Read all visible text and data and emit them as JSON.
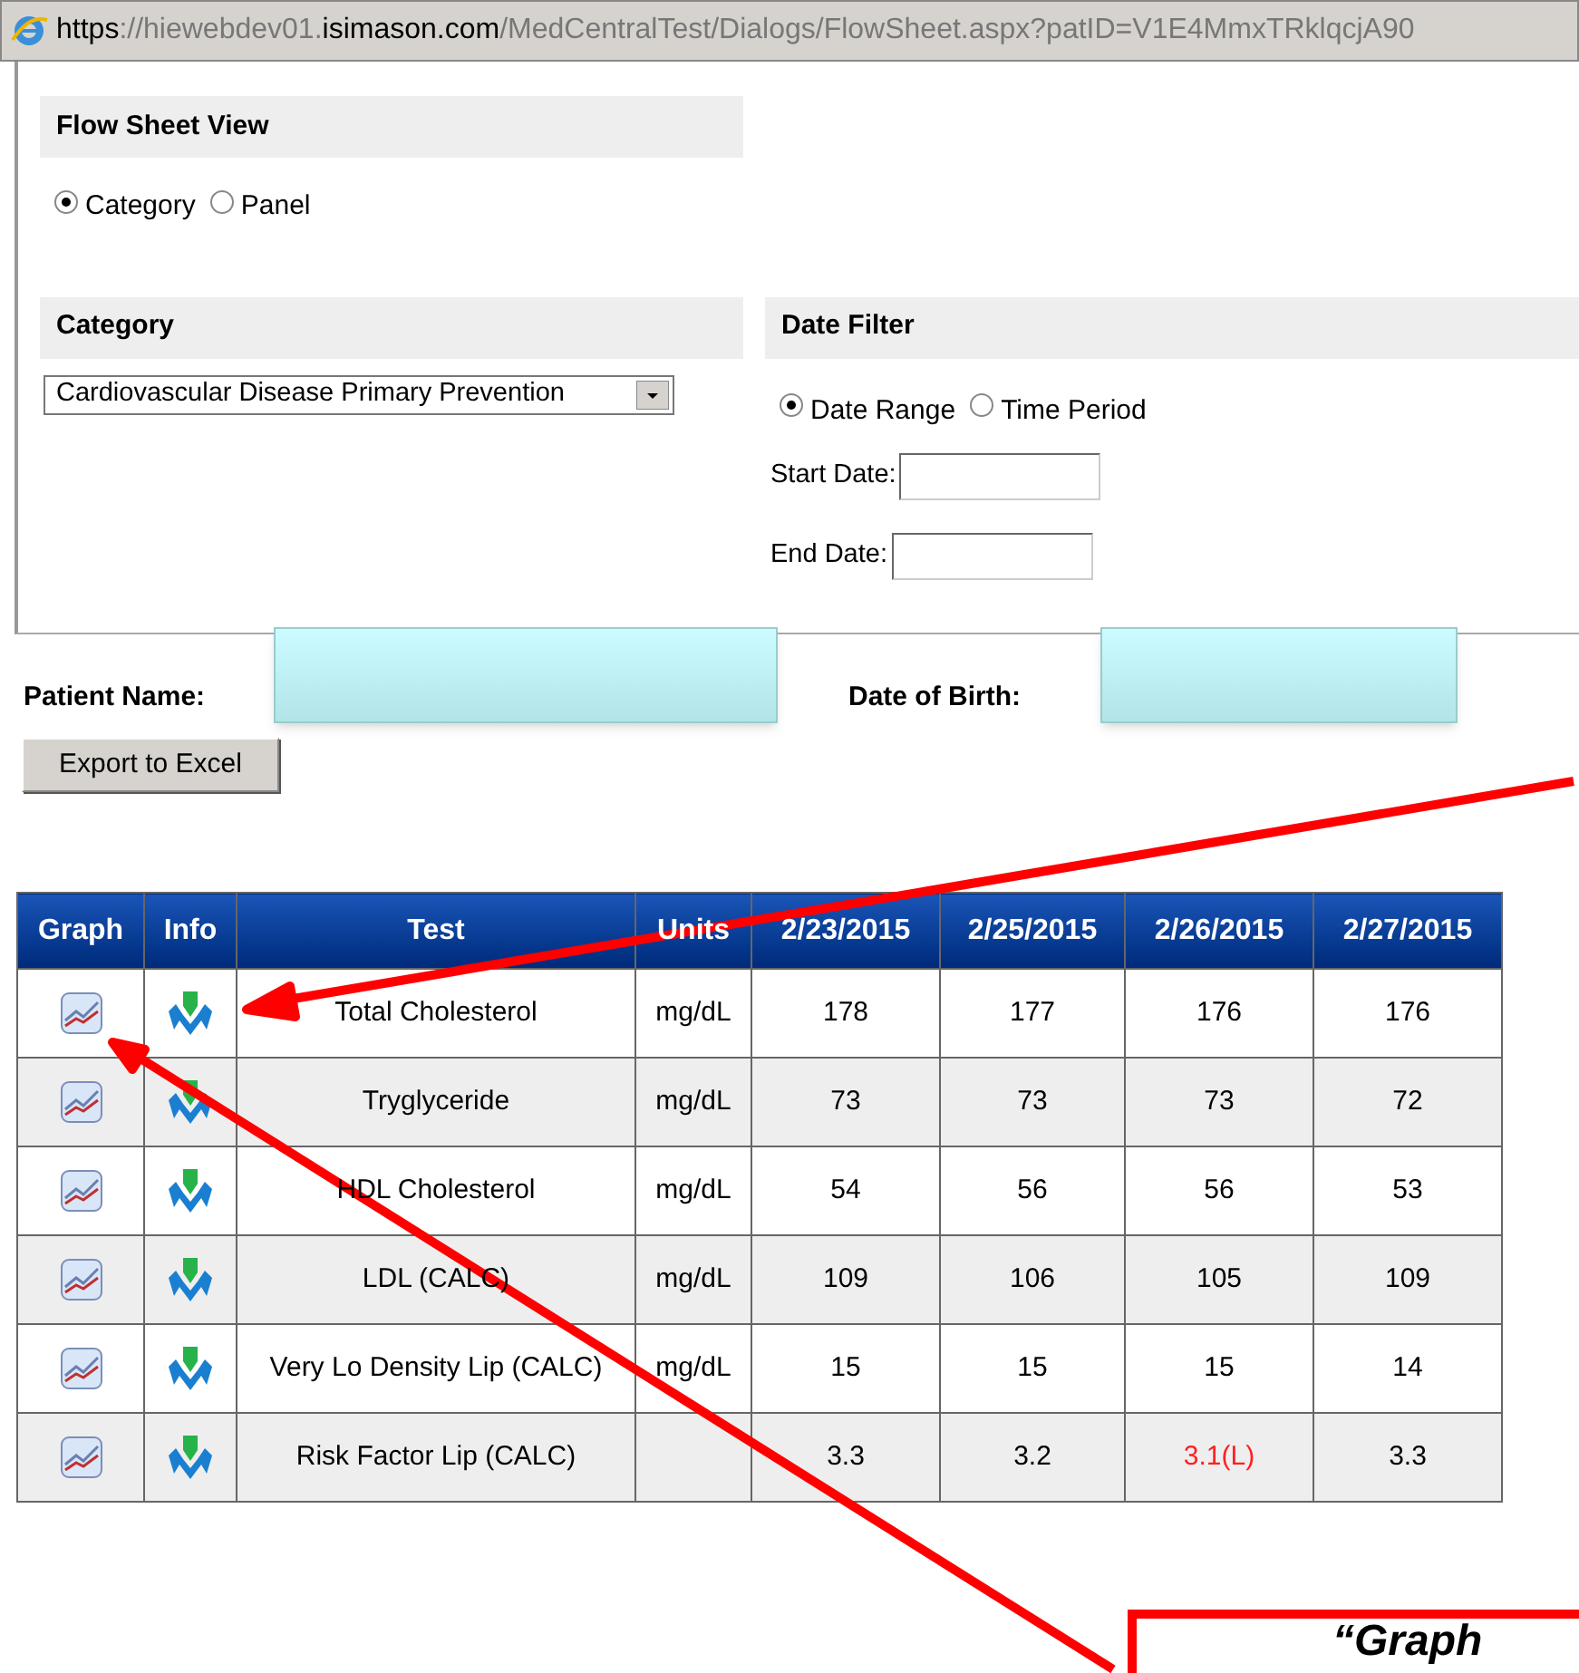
{
  "address_bar": {
    "scheme": "https",
    "sep": "://",
    "subdomain": "hiewebdev01.",
    "domain": "isimason.com",
    "path": "/MedCentralTest/Dialogs/FlowSheet.aspx?patID=V1E4MmxTRklqcjA90"
  },
  "flow_sheet_view": {
    "title": "Flow Sheet View",
    "options": [
      {
        "label": "Category",
        "selected": true
      },
      {
        "label": "Panel",
        "selected": false
      }
    ]
  },
  "category": {
    "title": "Category",
    "value": "Cardiovascular Disease Primary Prevention"
  },
  "date_filter": {
    "title": "Date Filter",
    "options": [
      {
        "label": "Date Range",
        "selected": true
      },
      {
        "label": "Time Period",
        "selected": false
      }
    ],
    "start_label": "Start Date:",
    "end_label": "End Date:"
  },
  "patient": {
    "name_label": "Patient Name:",
    "dob_label": "Date of Birth:"
  },
  "export_button": "Export to Excel",
  "table": {
    "columns": [
      "Graph",
      "Info",
      "Test",
      "Units",
      "2/23/2015",
      "2/25/2015",
      "2/26/2015",
      "2/27/2015"
    ],
    "rows": [
      {
        "test": "Total Cholesterol",
        "units": "mg/dL",
        "values": [
          {
            "text": "178",
            "low": false
          },
          {
            "text": "177",
            "low": false
          },
          {
            "text": "176",
            "low": false
          },
          {
            "text": "176",
            "low": false
          }
        ]
      },
      {
        "test": "Tryglyceride",
        "units": "mg/dL",
        "values": [
          {
            "text": "73",
            "low": false
          },
          {
            "text": "73",
            "low": false
          },
          {
            "text": "73",
            "low": false
          },
          {
            "text": "72",
            "low": false
          }
        ]
      },
      {
        "test": "HDL Cholesterol",
        "units": "mg/dL",
        "values": [
          {
            "text": "54",
            "low": false
          },
          {
            "text": "56",
            "low": false
          },
          {
            "text": "56",
            "low": false
          },
          {
            "text": "53",
            "low": false
          }
        ]
      },
      {
        "test": "LDL (CALC)",
        "units": "mg/dL",
        "values": [
          {
            "text": "109",
            "low": false
          },
          {
            "text": "106",
            "low": false
          },
          {
            "text": "105",
            "low": false
          },
          {
            "text": "109",
            "low": false
          }
        ]
      },
      {
        "test": "Very Lo Density Lip (CALC)",
        "units": "mg/dL",
        "values": [
          {
            "text": "15",
            "low": false
          },
          {
            "text": "15",
            "low": false
          },
          {
            "text": "15",
            "low": false
          },
          {
            "text": "14",
            "low": false
          }
        ]
      },
      {
        "test": "Risk Factor Lip (CALC)",
        "values": [
          {
            "text": "3.3",
            "low": false
          },
          {
            "text": "3.2",
            "low": false
          },
          {
            "text": "3.1(L)",
            "low": true
          },
          {
            "text": "3.3",
            "low": false
          }
        ]
      }
    ]
  },
  "callout": {
    "text": "“Graph"
  }
}
